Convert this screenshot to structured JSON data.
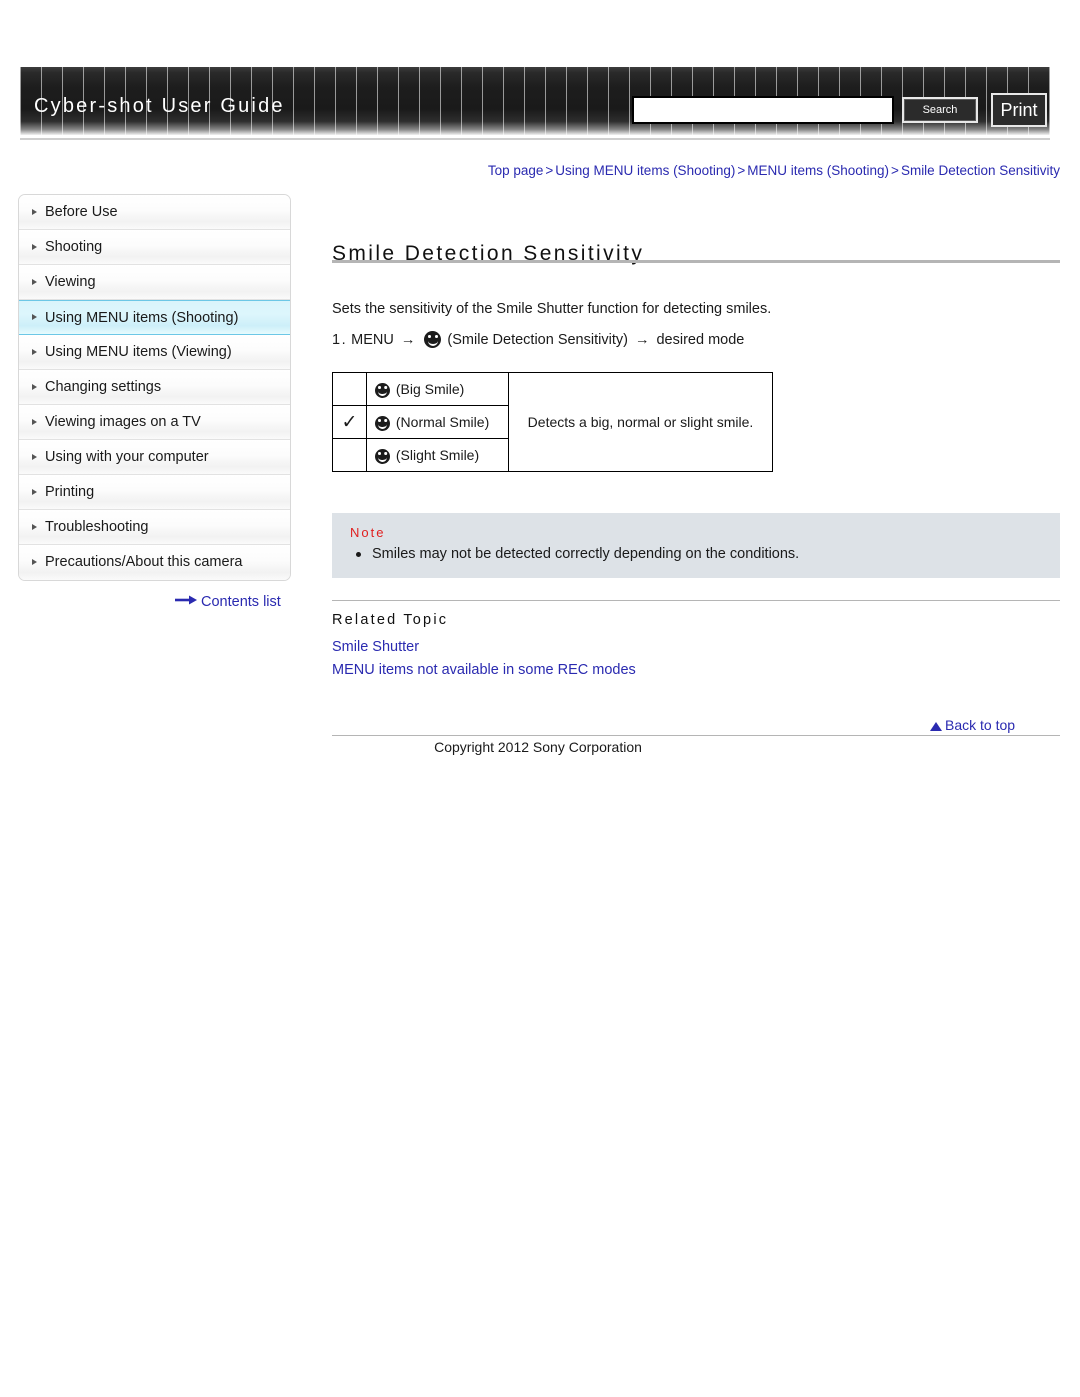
{
  "header": {
    "site_title": "Cyber-shot User Guide",
    "search_value": "",
    "search_placeholder": "",
    "search_label": "Search",
    "print_label": "Print"
  },
  "breadcrumb": {
    "separator": ">",
    "items": [
      "Top page",
      "Using MENU items (Shooting)",
      "MENU items (Shooting)",
      "Smile Detection Sensitivity"
    ]
  },
  "sidebar": {
    "items": [
      {
        "label": "Before Use",
        "selected": false
      },
      {
        "label": "Shooting",
        "selected": false
      },
      {
        "label": "Viewing",
        "selected": false
      },
      {
        "label": "Using MENU items (Shooting)",
        "selected": true
      },
      {
        "label": "Using MENU items (Viewing)",
        "selected": false
      },
      {
        "label": "Changing settings",
        "selected": false
      },
      {
        "label": "Viewing images on a TV",
        "selected": false
      },
      {
        "label": "Using with your computer",
        "selected": false
      },
      {
        "label": "Printing",
        "selected": false
      },
      {
        "label": "Troubleshooting",
        "selected": false
      },
      {
        "label": "Precautions/About this camera",
        "selected": false
      }
    ],
    "contents_list_label": "Contents list"
  },
  "main": {
    "title": "Smile Detection Sensitivity",
    "intro": "Sets the sensitivity of the Smile Shutter function for detecting smiles.",
    "step": {
      "number": "1.",
      "part1": "MENU",
      "arrow": "→",
      "icon": "smile-icon",
      "part2": "(Smile Detection Sensitivity)",
      "part3": "desired mode"
    },
    "table": {
      "rows": [
        {
          "checked": "",
          "icon": "smile-icon",
          "option": "(Big Smile)"
        },
        {
          "checked": "✓",
          "icon": "smile-icon",
          "option": "(Normal Smile)"
        },
        {
          "checked": "",
          "icon": "smile-icon",
          "option": "(Slight Smile)"
        }
      ],
      "description": "Detects a big, normal or slight smile."
    },
    "note": {
      "heading": "Note",
      "items": [
        "Smiles may not be detected correctly depending on the conditions."
      ]
    },
    "related": {
      "heading": "Related Topic",
      "links": [
        "Smile Shutter",
        "MENU items not available in some REC modes"
      ]
    }
  },
  "footer": {
    "back_to_top": "Back to top",
    "copyright": "Copyright 2012 Sony Corporation"
  },
  "colors": {
    "link": "#2a2ab0",
    "note_heading": "#e02020",
    "note_bg": "#dde2e7",
    "selected_nav": "#d9f4fb"
  }
}
